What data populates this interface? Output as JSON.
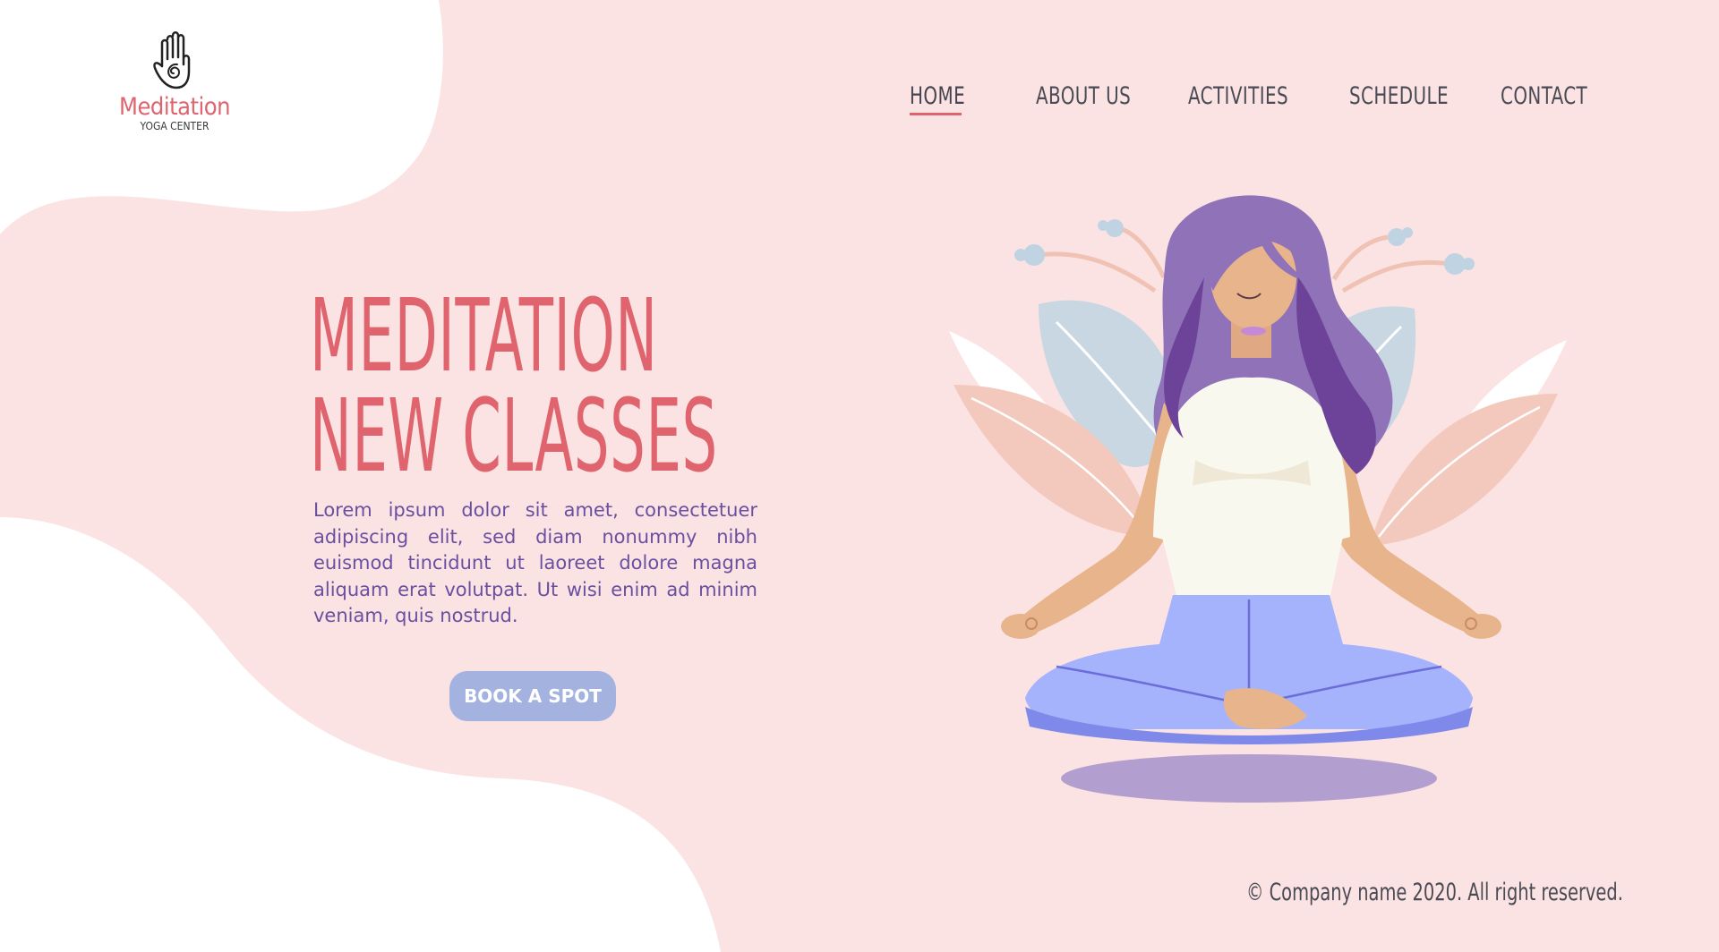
{
  "logo": {
    "icon": "hand-spiral-icon",
    "brand": "Meditation",
    "tagline": "YOGA CENTER"
  },
  "nav": {
    "items": [
      {
        "label": "HOME",
        "active": true
      },
      {
        "label": "ABOUT US",
        "active": false
      },
      {
        "label": "ACTIVITIES",
        "active": false
      },
      {
        "label": "SCHEDULE",
        "active": false
      },
      {
        "label": "CONTACT",
        "active": false
      }
    ]
  },
  "hero": {
    "title_line1": "MEDITATION",
    "title_line2": "NEW CLASSES",
    "body": "Lorem ipsum dolor sit amet, consectetuer adipiscing elit, sed diam nonummy nibh euismod tincidunt ut laoreet dolore magna aliquam erat volutpat. Ut wisi enim ad minim veniam, quis nostrud.",
    "cta_label": "BOOK A SPOT"
  },
  "illustration": {
    "icon": "meditating-woman-illustration"
  },
  "footer": {
    "copyright": "© Company name 2020. All right reserved."
  },
  "colors": {
    "background": "#fbe3e3",
    "accent": "#e0646e",
    "body_text": "#6a4fa0",
    "button": "#a4b2e0",
    "nav_text": "#4a4a55"
  }
}
